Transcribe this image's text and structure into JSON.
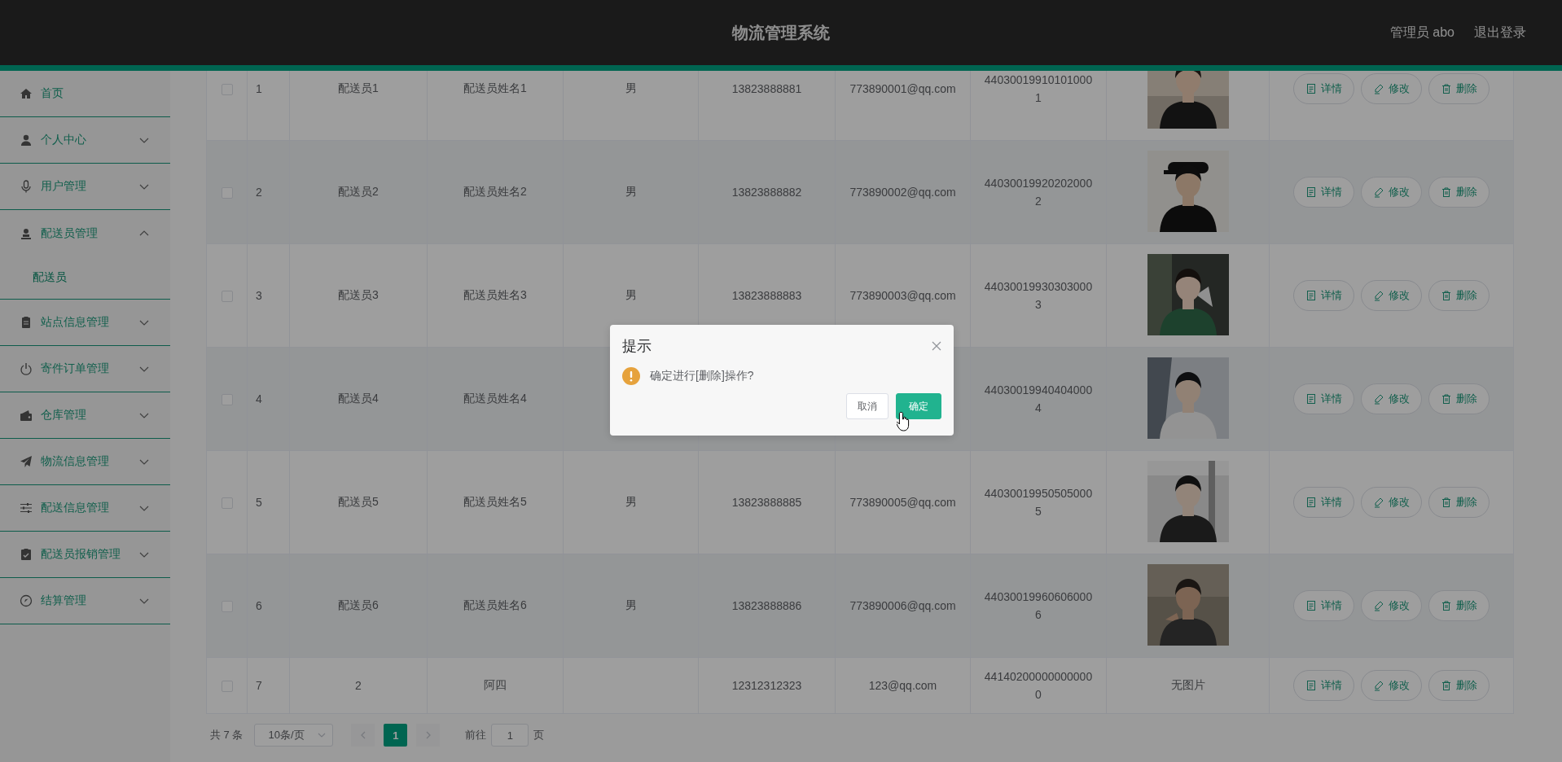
{
  "header": {
    "title": "物流管理系统",
    "user": "管理员 abo",
    "logout": "退出登录"
  },
  "sidebar": {
    "items": [
      {
        "kind": "link",
        "label": "首页"
      },
      {
        "kind": "menu",
        "label": "个人中心",
        "expanded": false
      },
      {
        "kind": "menu",
        "label": "用户管理",
        "expanded": false
      },
      {
        "kind": "menu",
        "label": "配送员管理",
        "expanded": true,
        "children": [
          {
            "label": "配送员",
            "selected": true
          }
        ]
      },
      {
        "kind": "menu",
        "label": "站点信息管理",
        "expanded": false
      },
      {
        "kind": "menu",
        "label": "寄件订单管理",
        "expanded": false
      },
      {
        "kind": "menu",
        "label": "仓库管理",
        "expanded": false
      },
      {
        "kind": "menu",
        "label": "物流信息管理",
        "expanded": false
      },
      {
        "kind": "menu",
        "label": "配送信息管理",
        "expanded": false
      },
      {
        "kind": "menu",
        "label": "配送员报销管理",
        "expanded": false
      },
      {
        "kind": "menu",
        "label": "结算管理",
        "expanded": false
      }
    ]
  },
  "table": {
    "rows": [
      {
        "checked": false,
        "index": "1",
        "account": "配送员1",
        "name": "配送员姓名1",
        "gender": "男",
        "phone": "13823888881",
        "email": "773890001@qq.com",
        "id_number": "440300199101010001",
        "actions": [
          {
            "kind": "detail",
            "label": "详情"
          },
          {
            "kind": "edit",
            "label": "修改"
          },
          {
            "kind": "delete",
            "label": "删除"
          }
        ]
      },
      {
        "checked": false,
        "index": "2",
        "account": "配送员2",
        "name": "配送员姓名2",
        "gender": "男",
        "phone": "13823888882",
        "email": "773890002@qq.com",
        "id_number": "440300199202020002",
        "actions": [
          {
            "kind": "detail",
            "label": "详情"
          },
          {
            "kind": "edit",
            "label": "修改"
          },
          {
            "kind": "delete",
            "label": "删除"
          }
        ]
      },
      {
        "checked": false,
        "index": "3",
        "account": "配送员3",
        "name": "配送员姓名3",
        "gender": "男",
        "phone": "13823888883",
        "email": "773890003@qq.com",
        "id_number": "440300199303030003",
        "actions": [
          {
            "kind": "detail",
            "label": "详情"
          },
          {
            "kind": "edit",
            "label": "修改"
          },
          {
            "kind": "delete",
            "label": "删除"
          }
        ]
      },
      {
        "checked": false,
        "index": "4",
        "account": "配送员4",
        "name": "配送员姓名4",
        "id_number": "440300199404040004",
        "actions": [
          {
            "kind": "detail",
            "label": "详情"
          },
          {
            "kind": "edit",
            "label": "修改"
          },
          {
            "kind": "delete",
            "label": "删除"
          }
        ]
      },
      {
        "checked": false,
        "index": "5",
        "account": "配送员5",
        "name": "配送员姓名5",
        "gender": "男",
        "phone": "13823888885",
        "email": "773890005@qq.com",
        "id_number": "440300199505050005",
        "actions": [
          {
            "kind": "detail",
            "label": "详情"
          },
          {
            "kind": "edit",
            "label": "修改"
          },
          {
            "kind": "delete",
            "label": "删除"
          }
        ]
      },
      {
        "checked": false,
        "index": "6",
        "account": "配送员6",
        "name": "配送员姓名6",
        "gender": "男",
        "phone": "13823888886",
        "email": "773890006@qq.com",
        "id_number": "440300199606060006",
        "actions": [
          {
            "kind": "detail",
            "label": "详情"
          },
          {
            "kind": "edit",
            "label": "修改"
          },
          {
            "kind": "delete",
            "label": "删除"
          }
        ]
      },
      {
        "checked": false,
        "index": "7",
        "account": "2",
        "name": "阿四",
        "phone": "12312312323",
        "email": "123@qq.com",
        "id_number": "441402000000000000",
        "photo_text": "无图片",
        "actions": [
          {
            "kind": "detail",
            "label": "详情"
          },
          {
            "kind": "edit",
            "label": "修改"
          },
          {
            "kind": "delete",
            "label": "删除"
          }
        ]
      }
    ]
  },
  "pagination": {
    "total": "共 7 条",
    "page_size": "10条/页",
    "pages": [
      {
        "label": "1",
        "selected": true
      }
    ],
    "goto_label": "前往",
    "goto_value": "1",
    "goto_unit": "页"
  },
  "dialog": {
    "title": "提示",
    "message": "确定进行[删除]操作?",
    "buttons": [
      {
        "kind": "cancel",
        "label": "取消"
      },
      {
        "kind": "confirm",
        "label": "确定"
      }
    ]
  }
}
